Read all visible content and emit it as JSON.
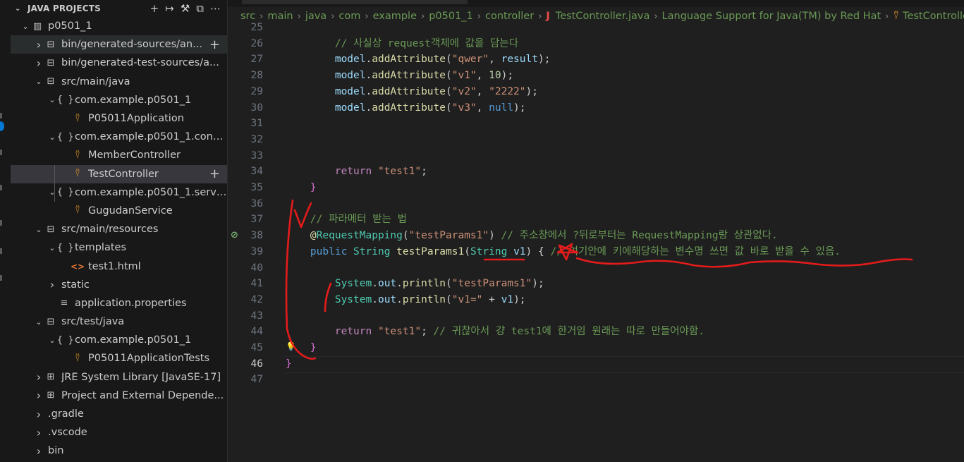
{
  "sidebar": {
    "title": "JAVA PROJECTS",
    "tree": [
      {
        "label": "p0501_1",
        "indent": 0,
        "twistie": "open",
        "icon": "project"
      },
      {
        "label": "bin/generated-sources/an...",
        "indent": 1,
        "twistie": "closed",
        "icon": "folder-lib",
        "state": "hover",
        "plus": true
      },
      {
        "label": "bin/generated-test-sources/a...",
        "indent": 1,
        "twistie": "closed",
        "icon": "folder-lib"
      },
      {
        "label": "src/main/java",
        "indent": 1,
        "twistie": "open",
        "icon": "folder-lib"
      },
      {
        "label": "com.example.p0501_1",
        "indent": 2,
        "twistie": "open",
        "icon": "package"
      },
      {
        "label": "P05011Application",
        "indent": 3,
        "twistie": "none",
        "icon": "class"
      },
      {
        "label": "com.example.p0501_1.contr...",
        "indent": 2,
        "twistie": "open",
        "icon": "package"
      },
      {
        "label": "MemberController",
        "indent": 3,
        "twistie": "none",
        "icon": "class"
      },
      {
        "label": "TestController",
        "indent": 3,
        "twistie": "none",
        "icon": "class",
        "state": "selected",
        "plus": true
      },
      {
        "label": "com.example.p0501_1.service",
        "indent": 2,
        "twistie": "open",
        "icon": "package"
      },
      {
        "label": "GugudanService",
        "indent": 3,
        "twistie": "none",
        "icon": "class"
      },
      {
        "label": "src/main/resources",
        "indent": 1,
        "twistie": "open",
        "icon": "folder-lib"
      },
      {
        "label": "templates",
        "indent": 2,
        "twistie": "open",
        "icon": "package"
      },
      {
        "label": "test1.html",
        "indent": 3,
        "twistie": "none",
        "icon": "html"
      },
      {
        "label": "static",
        "indent": 2,
        "twistie": "closed",
        "icon": "none"
      },
      {
        "label": "application.properties",
        "indent": 2,
        "twistie": "none",
        "icon": "properties"
      },
      {
        "label": "src/test/java",
        "indent": 1,
        "twistie": "open",
        "icon": "folder-lib"
      },
      {
        "label": "com.example.p0501_1",
        "indent": 2,
        "twistie": "open",
        "icon": "package"
      },
      {
        "label": "P05011ApplicationTests",
        "indent": 3,
        "twistie": "none",
        "icon": "class"
      },
      {
        "label": "JRE System Library [JavaSE-17]",
        "indent": 1,
        "twistie": "closed",
        "icon": "library"
      },
      {
        "label": "Project and External Depende...",
        "indent": 1,
        "twistie": "closed",
        "icon": "library"
      },
      {
        "label": ".gradle",
        "indent": 1,
        "twistie": "closed",
        "icon": "none"
      },
      {
        "label": ".vscode",
        "indent": 1,
        "twistie": "closed",
        "icon": "none"
      },
      {
        "label": "bin",
        "indent": 1,
        "twistie": "closed",
        "icon": "none"
      }
    ]
  },
  "breadcrumbs": [
    "src",
    "main",
    "java",
    "com",
    "example",
    "p0501_1",
    "controller",
    "TestController.java",
    "Language Support for Java(TM) by Red Hat",
    "TestControlle"
  ],
  "editor": {
    "current_line": 46,
    "lines": [
      {
        "n": 25,
        "tokens": []
      },
      {
        "n": 26,
        "tokens": [
          [
            "c",
            "        // 사실상 request객체에 값을 담는다"
          ]
        ]
      },
      {
        "n": 27,
        "tokens": [
          [
            "p",
            "        "
          ],
          [
            "v",
            "model"
          ],
          [
            "p",
            "."
          ],
          [
            "f",
            "addAttribute"
          ],
          [
            "p",
            "("
          ],
          [
            "s",
            "\"qwer\""
          ],
          [
            "p",
            ", "
          ],
          [
            "v",
            "result"
          ],
          [
            "p",
            ");"
          ]
        ]
      },
      {
        "n": 28,
        "tokens": [
          [
            "p",
            "        "
          ],
          [
            "v",
            "model"
          ],
          [
            "p",
            "."
          ],
          [
            "f",
            "addAttribute"
          ],
          [
            "p",
            "("
          ],
          [
            "s",
            "\"v1\""
          ],
          [
            "p",
            ", "
          ],
          [
            "n",
            "10"
          ],
          [
            "p",
            ");"
          ]
        ]
      },
      {
        "n": 29,
        "tokens": [
          [
            "p",
            "        "
          ],
          [
            "v",
            "model"
          ],
          [
            "p",
            "."
          ],
          [
            "f",
            "addAttribute"
          ],
          [
            "p",
            "("
          ],
          [
            "s",
            "\"v2\""
          ],
          [
            "p",
            ", "
          ],
          [
            "s",
            "\"2222\""
          ],
          [
            "p",
            ");"
          ]
        ]
      },
      {
        "n": 30,
        "tokens": [
          [
            "p",
            "        "
          ],
          [
            "v",
            "model"
          ],
          [
            "p",
            "."
          ],
          [
            "f",
            "addAttribute"
          ],
          [
            "p",
            "("
          ],
          [
            "s",
            "\"v3\""
          ],
          [
            "p",
            ", "
          ],
          [
            "k",
            "null"
          ],
          [
            "p",
            ");"
          ]
        ]
      },
      {
        "n": 31,
        "tokens": []
      },
      {
        "n": 32,
        "tokens": []
      },
      {
        "n": 33,
        "tokens": []
      },
      {
        "n": 34,
        "tokens": [
          [
            "p",
            "        "
          ],
          [
            "kc",
            "return"
          ],
          [
            "p",
            " "
          ],
          [
            "s",
            "\"test1\""
          ],
          [
            "p",
            ";"
          ]
        ]
      },
      {
        "n": 35,
        "tokens": [
          [
            "p",
            "    "
          ],
          [
            "brk",
            "}"
          ]
        ]
      },
      {
        "n": 36,
        "tokens": []
      },
      {
        "n": 37,
        "tokens": [
          [
            "p",
            "    "
          ],
          [
            "c",
            "// 파라메터 받는 법"
          ]
        ]
      },
      {
        "n": 38,
        "tokens": [
          [
            "p",
            "    "
          ],
          [
            "a",
            "@"
          ],
          [
            "t",
            "RequestMapping"
          ],
          [
            "p",
            "("
          ],
          [
            "s",
            "\"testParams1\""
          ],
          [
            "p",
            ") "
          ],
          [
            "c",
            "// 주소창에서 ?뒤로부터는 RequestMapping랑 상관없다."
          ]
        ]
      },
      {
        "n": 39,
        "tokens": [
          [
            "p",
            "    "
          ],
          [
            "k",
            "public"
          ],
          [
            "p",
            " "
          ],
          [
            "t",
            "String"
          ],
          [
            "p",
            " "
          ],
          [
            "f",
            "testParams1"
          ],
          [
            "p",
            "("
          ],
          [
            "t",
            "String"
          ],
          [
            "p",
            " "
          ],
          [
            "v",
            "v1"
          ],
          [
            "p",
            ") {"
          ],
          [
            "c",
            " // 여기안에 키에해당하는 변수명 쓰면 값 바로 받을 수 있음."
          ]
        ]
      },
      {
        "n": 40,
        "tokens": []
      },
      {
        "n": 41,
        "tokens": [
          [
            "p",
            "        "
          ],
          [
            "t",
            "System"
          ],
          [
            "p",
            "."
          ],
          [
            "v",
            "out"
          ],
          [
            "p",
            "."
          ],
          [
            "f",
            "println"
          ],
          [
            "p",
            "("
          ],
          [
            "s",
            "\"testParams1\""
          ],
          [
            "p",
            ");"
          ]
        ]
      },
      {
        "n": 42,
        "tokens": [
          [
            "p",
            "        "
          ],
          [
            "t",
            "System"
          ],
          [
            "p",
            "."
          ],
          [
            "v",
            "out"
          ],
          [
            "p",
            "."
          ],
          [
            "f",
            "println"
          ],
          [
            "p",
            "("
          ],
          [
            "s",
            "\"v1=\""
          ],
          [
            "p",
            " + "
          ],
          [
            "v",
            "v1"
          ],
          [
            "p",
            ");"
          ]
        ]
      },
      {
        "n": 43,
        "tokens": []
      },
      {
        "n": 44,
        "tokens": [
          [
            "p",
            "        "
          ],
          [
            "kc",
            "return"
          ],
          [
            "p",
            " "
          ],
          [
            "s",
            "\"test1\""
          ],
          [
            "p",
            "; "
          ],
          [
            "c",
            "// 귀찮아서 걍 test1에 한거임 원래는 따로 만들어야함."
          ]
        ]
      },
      {
        "n": 45,
        "tokens": [
          [
            "p",
            "    "
          ],
          [
            "brk",
            "}"
          ]
        ]
      },
      {
        "n": 46,
        "tokens": [
          [
            "brk",
            "}"
          ]
        ]
      },
      {
        "n": 47,
        "tokens": []
      }
    ]
  },
  "colors": {
    "annotation": "#e51b1b",
    "accent": "#0078d4"
  }
}
